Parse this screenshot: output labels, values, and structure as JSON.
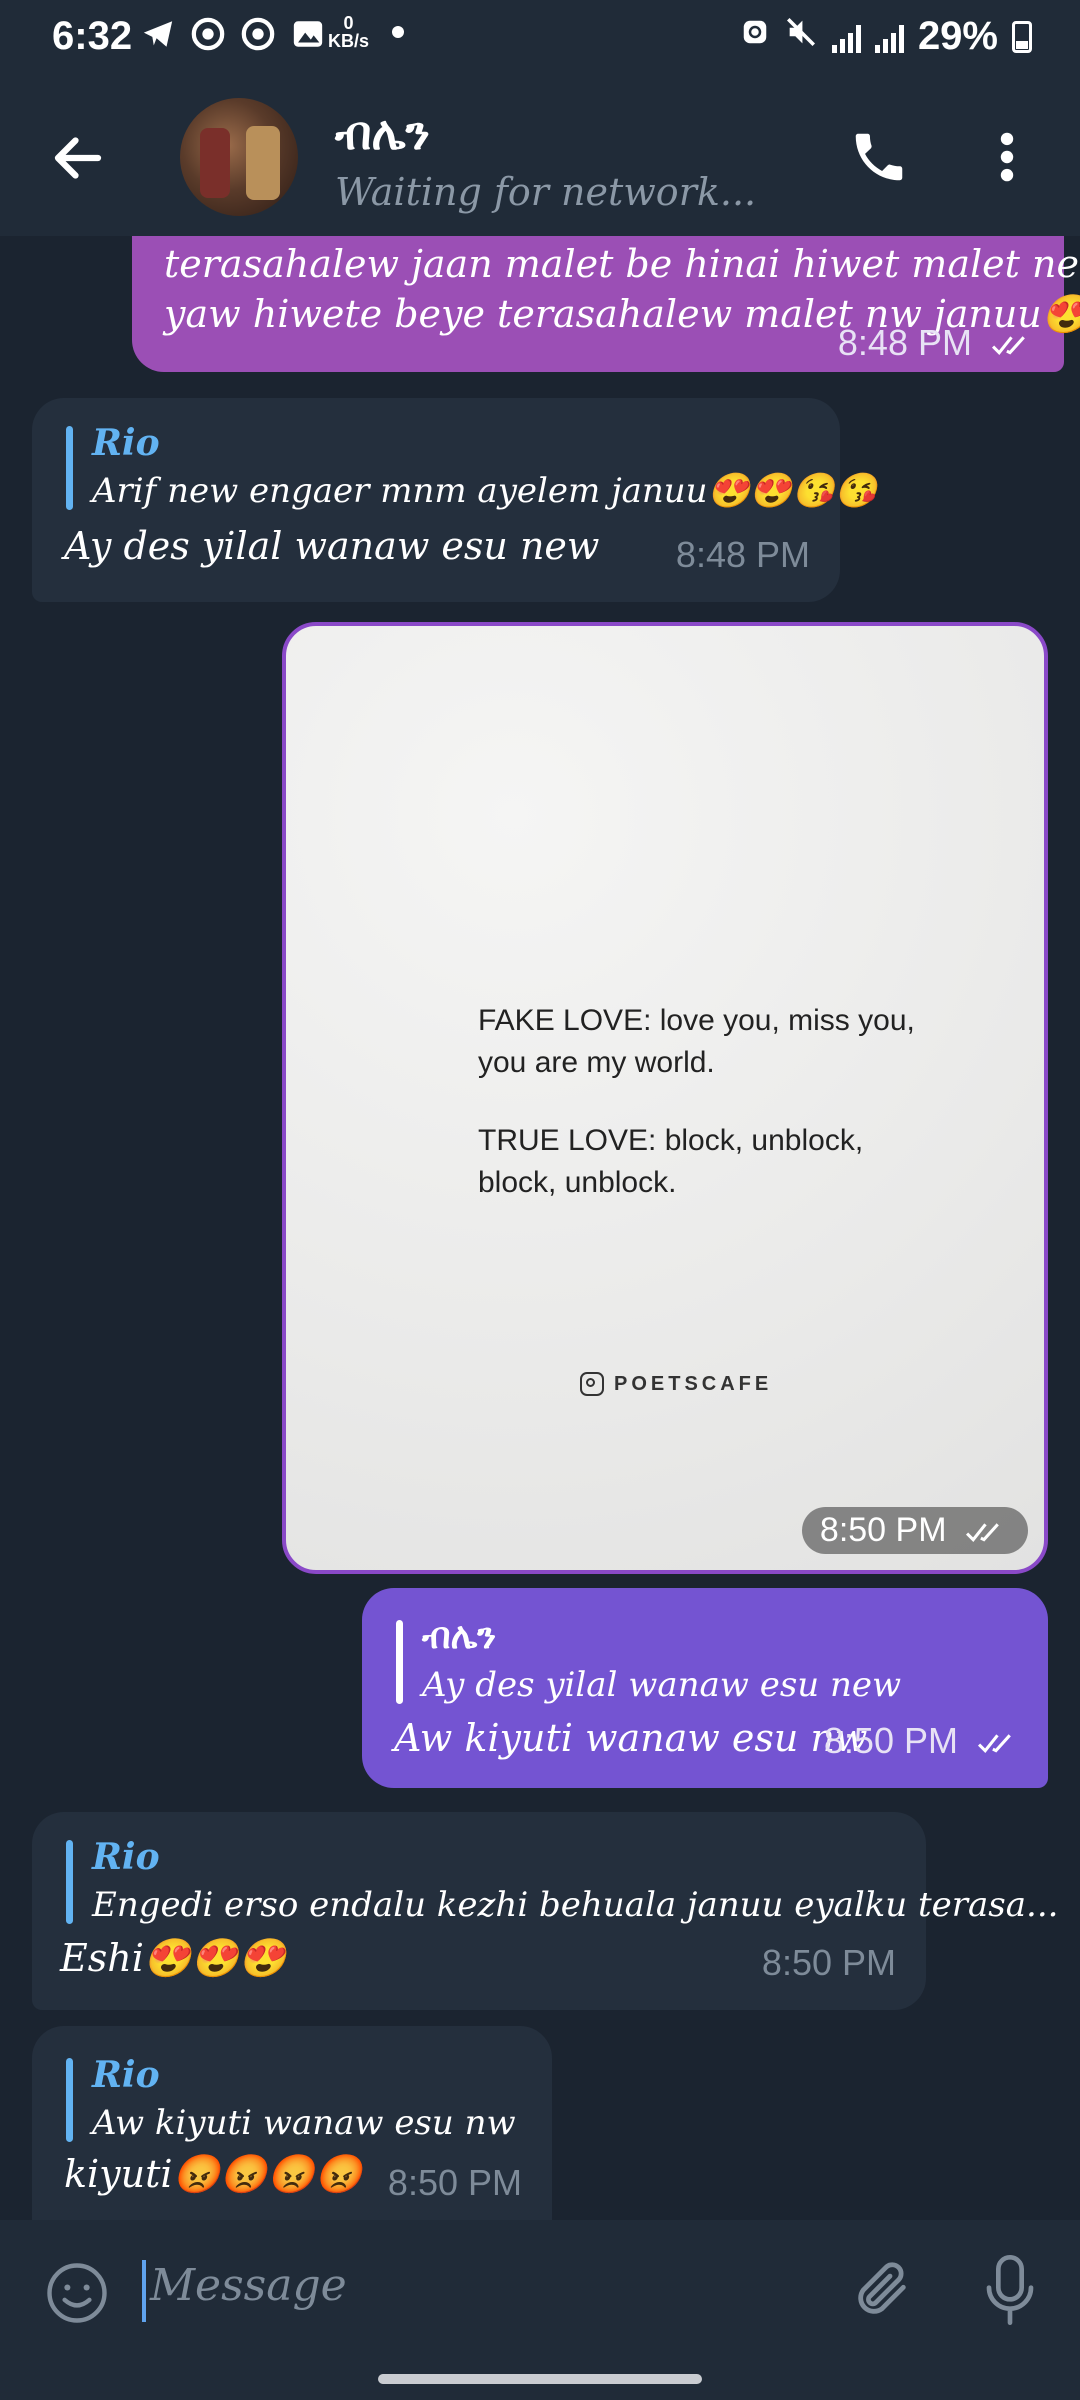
{
  "status_bar": {
    "time": "6:32",
    "kbs_value": "0",
    "kbs_unit": "KB/s",
    "battery": "29%"
  },
  "header": {
    "title": "ብሌን",
    "status": "Waiting for network..."
  },
  "messages": {
    "m1": {
      "line1": "terasahalew jaan malet be hinai hiwet malet new",
      "line2": "yaw hiwete beye terasahalew malet nw januu😍😍",
      "time": "8:48 PM"
    },
    "m2": {
      "reply_name": "Rio",
      "reply_text": "Arif new engaer mnm ayelem januu😍😍😘😘",
      "text": "Ay des yilal wanaw esu new",
      "time": "8:48 PM"
    },
    "m3": {
      "image_line1": "FAKE LOVE: love you, miss you,",
      "image_line2": "you are my world.",
      "image_line3": "TRUE LOVE: block, unblock,",
      "image_line4": "block, unblock.",
      "image_brand": "POETSCAFE",
      "time": "8:50 PM"
    },
    "m4": {
      "reply_name": "ብሌን",
      "reply_text": "Ay des yilal wanaw esu new",
      "text": "Aw kiyuti wanaw esu nw",
      "time": "8:50 PM"
    },
    "m5": {
      "reply_name": "Rio",
      "reply_text": "Engedi erso endalu kezhi behuala januu eyalku terasa...",
      "text": "Eshi😍😍😍",
      "time": "8:50 PM"
    },
    "m6": {
      "reply_name": "Rio",
      "reply_text": "Aw kiyuti wanaw esu nw",
      "text": "kiyuti😡😡😡😡",
      "time": "8:50 PM"
    }
  },
  "input": {
    "placeholder": "Message"
  },
  "colors": {
    "background": "#1b2430",
    "bar": "#202b38",
    "outgoing_purple": "#9b4fb5",
    "outgoing_violet": "#7454d2",
    "incoming": "#242f3d",
    "reply_accent": "#62b3f2"
  }
}
